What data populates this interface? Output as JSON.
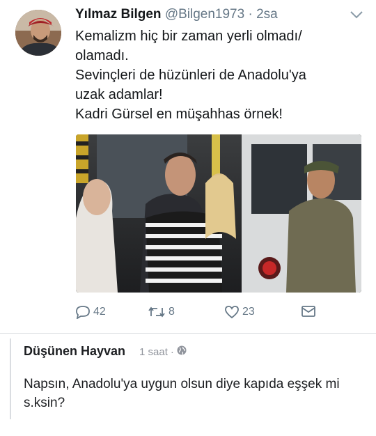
{
  "tweet": {
    "display_name": "Yılmaz Bilgen",
    "handle": "@Bilgen1973",
    "separator": "·",
    "time": "2sa",
    "text_lines": [
      "Kemalizm hiç bir zaman yerli olmadı/",
      "olamadı.",
      "Sevinçleri de hüzünleri de Anadolu'ya",
      "uzak adamlar!",
      "Kadri Gürsel en müşahhas örnek!"
    ],
    "actions": {
      "replies": "42",
      "retweets": "8",
      "likes": "23"
    },
    "icons": {
      "reply": "reply-icon",
      "retweet": "retweet-icon",
      "like": "heart-icon",
      "message": "envelope-icon",
      "more": "chevron-down-icon"
    }
  },
  "comment": {
    "author": "Düşünen Hayvan",
    "time": "1 saat",
    "separator": "·",
    "privacy_icon": "globe-icon",
    "text": "Napsın, Anadolu'ya uygun olsun diye kapıda eşşek mi s.ksin?"
  },
  "colors": {
    "text_primary": "#14171a",
    "text_secondary": "#657786",
    "comment_meta": "#90949c"
  }
}
